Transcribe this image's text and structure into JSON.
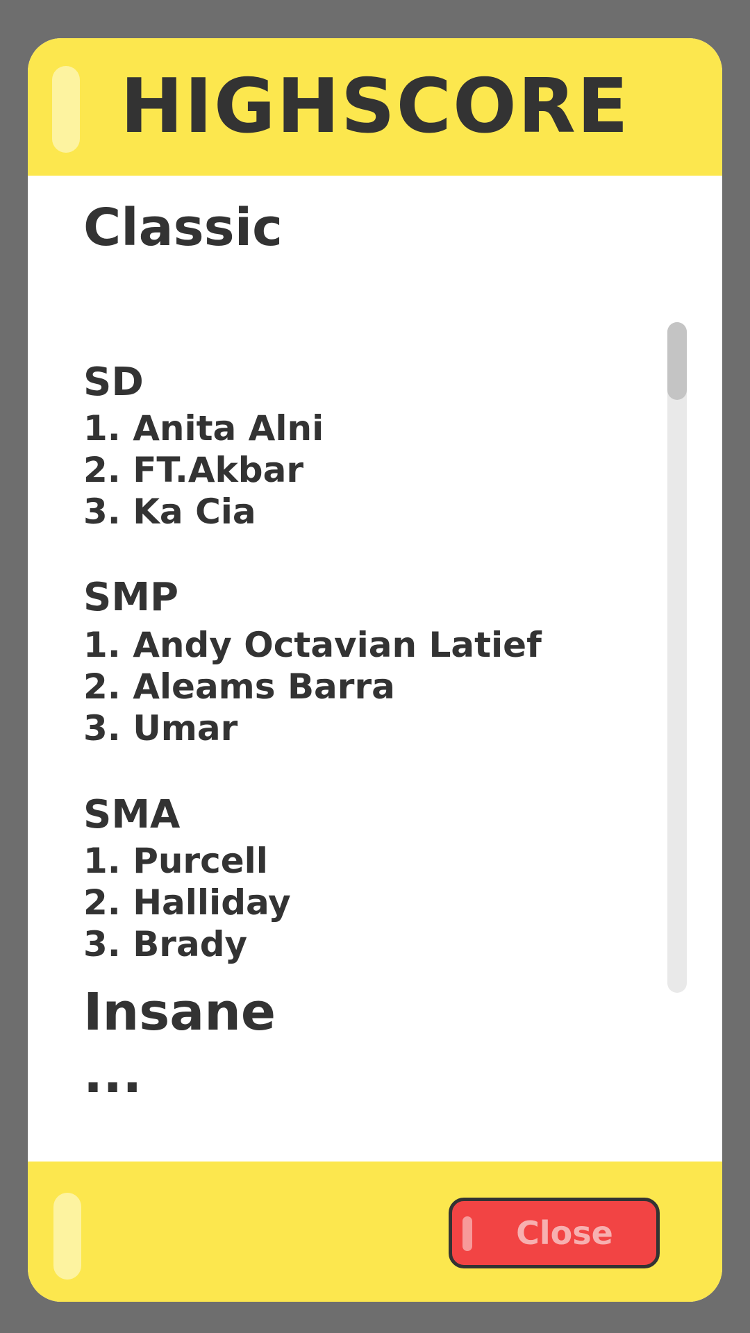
{
  "header": {
    "title": "HIGHSCORE"
  },
  "modes": [
    {
      "name": "Classic",
      "levels": [
        {
          "name": "SD",
          "entries": [
            "1. Anita Alni",
            "2. FT.Akbar",
            "3. Ka Cia"
          ]
        },
        {
          "name": "SMP",
          "entries": [
            "1. Andy Octavian Latief",
            "2. Aleams Barra",
            "3. Umar"
          ]
        },
        {
          "name": "SMA",
          "entries": [
            "1. Purcell",
            "2. Halliday",
            "3. Brady"
          ]
        }
      ]
    },
    {
      "name": "Insane",
      "placeholder": "..."
    }
  ],
  "footer": {
    "close_label": "Close"
  },
  "colors": {
    "backdrop": "#6e6e6e",
    "panel_yellow": "#fce74e",
    "text_dark": "#333333",
    "close_red": "#f24444",
    "scroll_track": "#e9e9e9",
    "scroll_thumb": "#c4c4c4"
  }
}
